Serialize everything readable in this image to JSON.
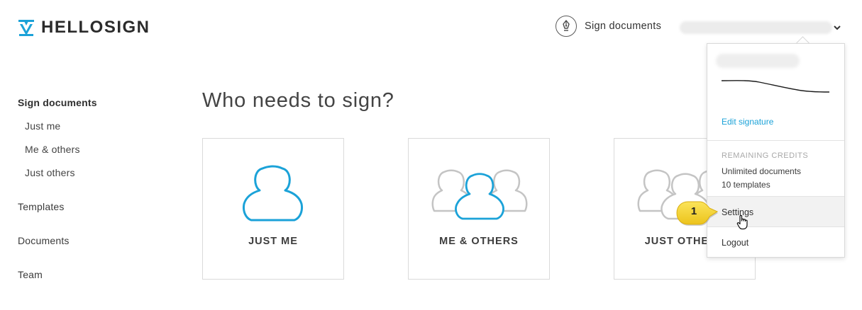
{
  "header": {
    "logo_text": "HELLOSIGN",
    "sign_documents_label": "Sign documents"
  },
  "sidebar": {
    "items": [
      {
        "label": "Sign documents",
        "type": "heading"
      },
      {
        "label": "Just me",
        "type": "sub"
      },
      {
        "label": "Me & others",
        "type": "sub"
      },
      {
        "label": "Just others",
        "type": "sub"
      },
      {
        "label": "Templates",
        "type": "heading"
      },
      {
        "label": "Documents",
        "type": "heading"
      },
      {
        "label": "Team",
        "type": "heading"
      }
    ]
  },
  "main": {
    "title": "Who needs to sign?",
    "cards": [
      {
        "label": "JUST ME",
        "icon": "single-person-icon"
      },
      {
        "label": "ME & OTHERS",
        "icon": "group-me-highlighted-icon"
      },
      {
        "label": "JUST OTHERS",
        "icon": "group-others-icon"
      }
    ]
  },
  "dropdown": {
    "edit_signature": "Edit signature",
    "credits_heading": "REMAINING CREDITS",
    "credits": [
      "Unlimited documents",
      "10 templates"
    ],
    "settings": "Settings",
    "logout": "Logout"
  },
  "annotation": {
    "step_number": "1"
  },
  "colors": {
    "accent": "#1ba2d8",
    "icon_gray": "#c4c4c4",
    "callout_yellow": "#f4d22c"
  }
}
